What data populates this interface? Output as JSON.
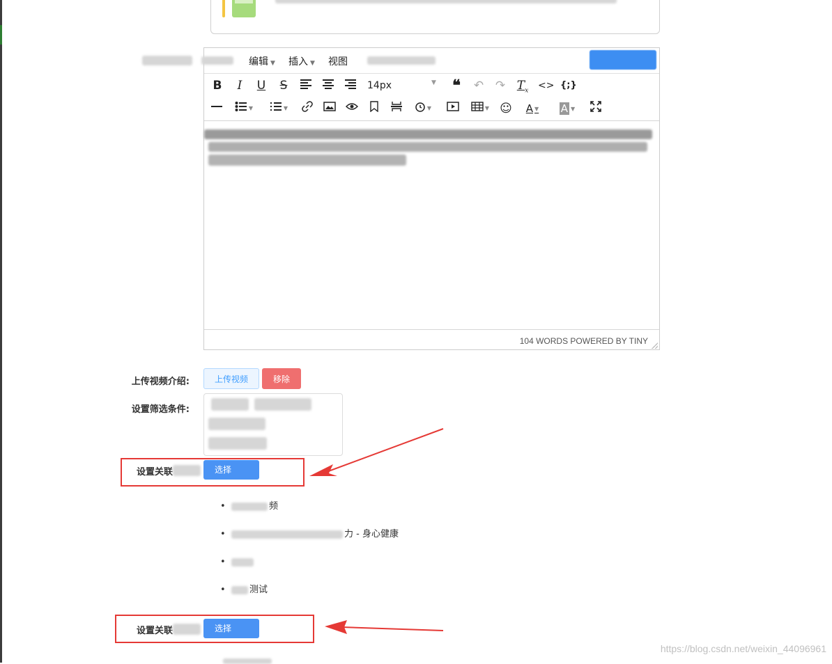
{
  "editor": {
    "menu": [
      {
        "label": "编辑"
      },
      {
        "label": "插入"
      },
      {
        "label": "视图"
      }
    ],
    "font_size": "14px",
    "status": "104 WORDS POWERED BY TINY",
    "toolbar_icons": [
      "bold-icon",
      "italic-icon",
      "underline-icon",
      "strikethrough-icon",
      "align-left-icon",
      "align-center-icon",
      "align-right-icon",
      "blockquote-icon",
      "undo-icon",
      "redo-icon",
      "clear-format-icon",
      "code-icon",
      "code-sample-icon",
      "horizontal-rule-icon",
      "bullet-list-icon",
      "numbered-list-icon",
      "link-icon",
      "image-icon",
      "preview-icon",
      "bookmark-icon",
      "page-break-icon",
      "clock-icon",
      "media-icon",
      "table-icon",
      "emoji-icon",
      "text-color-icon",
      "background-color-icon",
      "fullscreen-icon"
    ]
  },
  "form": {
    "upload_label": "上传视频介绍:",
    "upload_button": "上传视频",
    "remove_button": "移除",
    "filter_label": "设置筛选条件:",
    "related_label": "设置关联",
    "choose_button": "选择"
  },
  "related_list": [
    {
      "text": "频"
    },
    {
      "text": "力 - 身心健康"
    },
    {
      "text": ""
    },
    {
      "text": "测试"
    }
  ],
  "watermark": "https://blog.csdn.net/weixin_44096961",
  "colors": {
    "primary": "#4a93f4",
    "danger": "#ef6f6f",
    "annotation": "#e53935"
  }
}
